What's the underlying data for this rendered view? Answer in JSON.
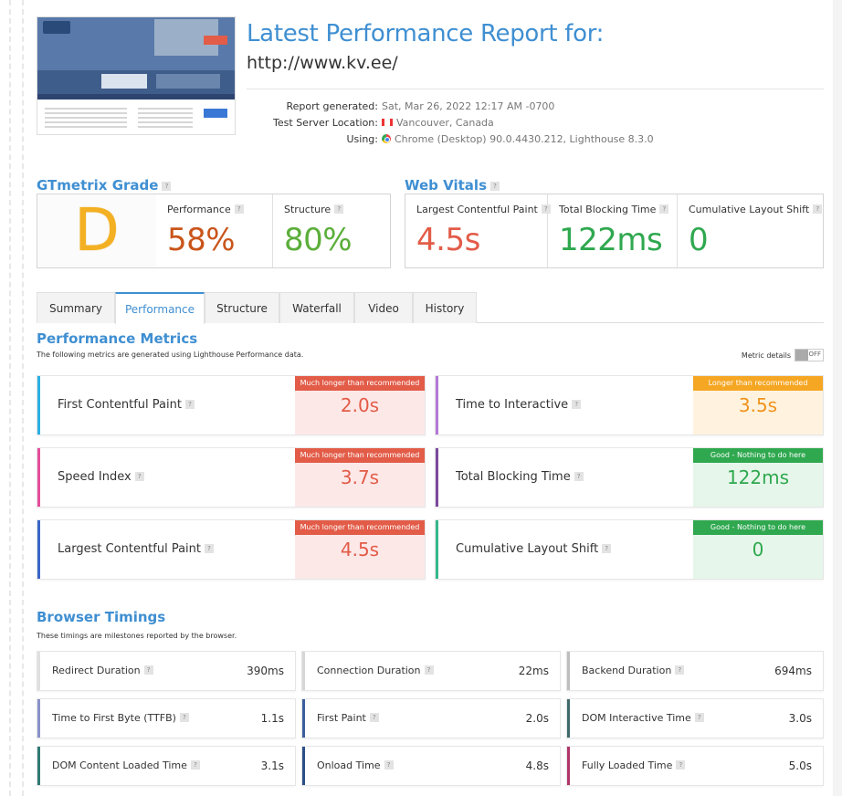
{
  "header": {
    "title": "Latest Performance Report for:",
    "url": "http://www.kv.ee/",
    "meta": [
      {
        "label": "Report generated:",
        "value": "Sat, Mar 26, 2022 12:17 AM -0700",
        "icon": ""
      },
      {
        "label": "Test Server Location:",
        "value": "Vancouver, Canada",
        "icon": "canada-flag-icon"
      },
      {
        "label": "Using:",
        "value": "Chrome (Desktop) 90.0.4430.212, Lighthouse 8.3.0",
        "icon": "chrome-icon"
      }
    ]
  },
  "grade": {
    "title": "GTmetrix Grade",
    "letter": "D",
    "performance_label": "Performance",
    "performance_value": "58%",
    "structure_label": "Structure",
    "structure_value": "80%"
  },
  "vitals": {
    "title": "Web Vitals",
    "lcp_label": "Largest Contentful Paint",
    "lcp_value": "4.5s",
    "tbt_label": "Total Blocking Time",
    "tbt_value": "122ms",
    "cls_label": "Cumulative Layout Shift",
    "cls_value": "0"
  },
  "tabs": [
    "Summary",
    "Performance",
    "Structure",
    "Waterfall",
    "Video",
    "History"
  ],
  "active_tab": "Performance",
  "performance_metrics": {
    "title": "Performance Metrics",
    "subtitle": "The following metrics are generated using Lighthouse Performance data.",
    "toggle_label": "Metric details",
    "toggle_state": "OFF",
    "items": [
      {
        "name": "First Contentful Paint",
        "value": "2.0s",
        "tag": "Much longer than recommended",
        "status": "bad"
      },
      {
        "name": "Time to Interactive",
        "value": "3.5s",
        "tag": "Longer than recommended",
        "status": "warn"
      },
      {
        "name": "Speed Index",
        "value": "3.7s",
        "tag": "Much longer than recommended",
        "status": "bad"
      },
      {
        "name": "Total Blocking Time",
        "value": "122ms",
        "tag": "Good - Nothing to do here",
        "status": "good"
      },
      {
        "name": "Largest Contentful Paint",
        "value": "4.5s",
        "tag": "Much longer than recommended",
        "status": "bad"
      },
      {
        "name": "Cumulative Layout Shift",
        "value": "0",
        "tag": "Good - Nothing to do here",
        "status": "good"
      }
    ]
  },
  "browser_timings": {
    "title": "Browser Timings",
    "subtitle": "These timings are milestones reported by the browser.",
    "items": [
      {
        "name": "Redirect Duration",
        "value": "390ms"
      },
      {
        "name": "Connection Duration",
        "value": "22ms"
      },
      {
        "name": "Backend Duration",
        "value": "694ms"
      },
      {
        "name": "Time to First Byte (TTFB)",
        "value": "1.1s"
      },
      {
        "name": "First Paint",
        "value": "2.0s"
      },
      {
        "name": "DOM Interactive Time",
        "value": "3.0s"
      },
      {
        "name": "DOM Content Loaded Time",
        "value": "3.1s"
      },
      {
        "name": "Onload Time",
        "value": "4.8s"
      },
      {
        "name": "Fully Loaded Time",
        "value": "5.0s"
      }
    ]
  },
  "thumbnail_text": "KVEE",
  "colors": {
    "brand_blue": "#3f8fd2",
    "grade_d": "#f3b022",
    "bad": "#e25c48",
    "bad_bg": "#fde8e8",
    "warn": "#f5a623",
    "warn_bg": "#fff3df",
    "good": "#2fa84f",
    "good_bg": "#e6f6ea"
  }
}
